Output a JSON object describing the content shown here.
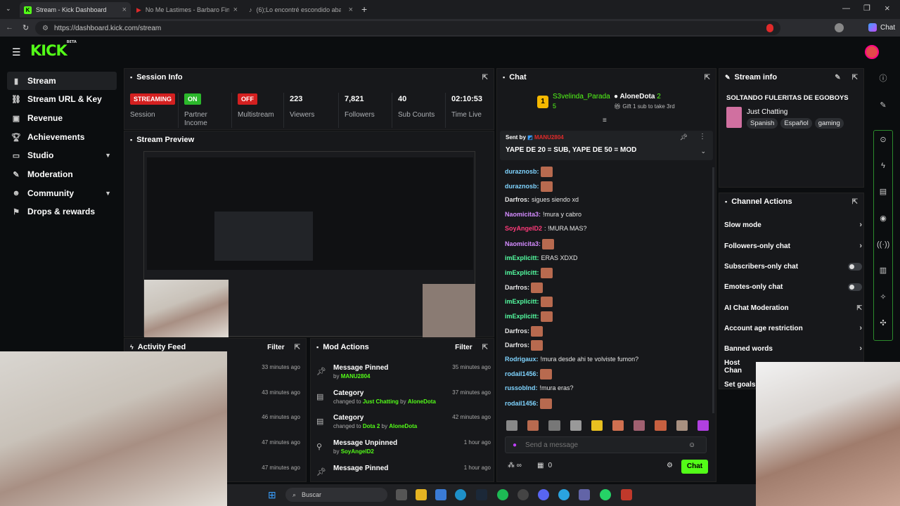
{
  "browser": {
    "tabs": [
      {
        "title": "Stream - Kick Dashboard"
      },
      {
        "title": "No Me Lastimes - Barbaro Fines y"
      },
      {
        "title": "(6);Lo encontré escondido abajo d"
      }
    ],
    "url": "https://dashboard.kick.com/stream",
    "profile_label": "Chat"
  },
  "app": {
    "logo": "KICK",
    "logo_badge": "BETA"
  },
  "sidebar": {
    "items": [
      {
        "label": "Stream",
        "icon": "stream-icon"
      },
      {
        "label": "Stream URL & Key",
        "icon": "link-icon"
      },
      {
        "label": "Revenue",
        "icon": "revenue-icon"
      },
      {
        "label": "Achievements",
        "icon": "trophy-icon"
      },
      {
        "label": "Studio",
        "icon": "studio-icon"
      },
      {
        "label": "Moderation",
        "icon": "moderation-icon"
      },
      {
        "label": "Community",
        "icon": "community-icon"
      },
      {
        "label": "Drops & rewards",
        "icon": "drops-icon"
      }
    ]
  },
  "session": {
    "title": "Session Info",
    "stats": [
      {
        "value": "STREAMING",
        "label": "Session"
      },
      {
        "value": "ON",
        "label": "Partner Income"
      },
      {
        "value": "OFF",
        "label": "Multistream"
      },
      {
        "value": "223",
        "label": "Viewers"
      },
      {
        "value": "7,821",
        "label": "Followers"
      },
      {
        "value": "40",
        "label": "Sub Counts"
      },
      {
        "value": "02:10:53",
        "label": "Time Live"
      }
    ]
  },
  "preview": {
    "title": "Stream Preview"
  },
  "activity": {
    "title": "Activity Feed",
    "filter": "Filter",
    "times": [
      "33 minutes ago",
      "43 minutes ago",
      "46 minutes ago",
      "47 minutes ago",
      "47 minutes ago"
    ]
  },
  "mod": {
    "title": "Mod Actions",
    "filter": "Filter",
    "rows": [
      {
        "title": "Message Pinned",
        "pre": "by",
        "user": "MANU2804",
        "mid": "",
        "user2": "",
        "time": "35 minutes ago"
      },
      {
        "title": "Category",
        "pre": "changed to",
        "user": "Just Chatting",
        "mid": "by",
        "user2": "AloneDota",
        "time": "37 minutes ago"
      },
      {
        "title": "Category",
        "pre": "changed to",
        "user": "Dota 2",
        "mid": "by",
        "user2": "AloneDota",
        "time": "42 minutes ago"
      },
      {
        "title": "Message Unpinned",
        "pre": "by",
        "user": "SoyAngelD2",
        "mid": "",
        "user2": "",
        "time": "1 hour ago"
      },
      {
        "title": "Message Pinned",
        "pre": "",
        "user": "",
        "mid": "",
        "user2": "",
        "time": "1 hour ago"
      }
    ]
  },
  "chat": {
    "title": "Chat",
    "top_gifter": {
      "rank": "1",
      "name": "S3velinda_Parada",
      "count": "5"
    },
    "second": {
      "name": "AloneDota",
      "count": "2",
      "note": "Gift 1 sub to take 3rd"
    },
    "pinned": {
      "sent_by": "Sent by",
      "user": "MANU2804",
      "message": "YAPE DE 20 = SUB, YAPE DE 50 = MOD"
    },
    "messages": [
      {
        "user": "duraznosb:",
        "text": "",
        "emote": true,
        "color": "#7fd4ff"
      },
      {
        "user": "duraznosb:",
        "text": "",
        "emote": true,
        "color": "#7fd4ff"
      },
      {
        "user": "Darfros:",
        "text": "sigues siendo xd",
        "emote": false,
        "color": "#e6e6e6"
      },
      {
        "user": "Naomicita3:",
        "text": "!mura y cabro",
        "emote": false,
        "color": "#d48cff"
      },
      {
        "user": "SoyAngelD2",
        "text": ": !MURA MAS?",
        "emote": false,
        "color": "#ff3a7a"
      },
      {
        "user": "Naomicita3:",
        "text": "",
        "emote": true,
        "color": "#d48cff"
      },
      {
        "user": "imExplicitt:",
        "text": "ERAS XDXD",
        "emote": false,
        "color": "#53fca0"
      },
      {
        "user": "imExplicitt:",
        "text": "",
        "emote": true,
        "color": "#53fca0"
      },
      {
        "user": "Darfros:",
        "text": "",
        "emote": true,
        "color": "#e6e6e6"
      },
      {
        "user": "imExplicitt:",
        "text": "",
        "emote": true,
        "color": "#53fca0"
      },
      {
        "user": "imExplicitt:",
        "text": "",
        "emote": true,
        "color": "#53fca0"
      },
      {
        "user": "Darfros:",
        "text": "",
        "emote": true,
        "color": "#e6e6e6"
      },
      {
        "user": "Darfros:",
        "text": "",
        "emote": true,
        "color": "#e6e6e6"
      },
      {
        "user": "Rodrigaux:",
        "text": "!mura desde ahi te volviste fumon?",
        "emote": false,
        "color": "#7fd4ff"
      },
      {
        "user": "rodail1456:",
        "text": "",
        "emote": true,
        "color": "#7fd4ff"
      },
      {
        "user": "russobInd:",
        "text": "!mura eras?",
        "emote": false,
        "color": "#7fd4ff"
      },
      {
        "user": "rodail1456:",
        "text": "",
        "emote": true,
        "color": "#7fd4ff"
      }
    ],
    "placeholder": "Send a message",
    "counter": "0",
    "send": "Chat"
  },
  "stream_info": {
    "title": "Stream info",
    "stream_title": "SOLTANDO FULERITAS DE EGOBOYS",
    "category": "Just Chatting",
    "tags": [
      "Spanish",
      "Español",
      "gaming"
    ]
  },
  "channel_actions": {
    "title": "Channel Actions",
    "rows": [
      {
        "label": "Slow mode",
        "control": "chevron"
      },
      {
        "label": "Followers-only chat",
        "control": "chevron"
      },
      {
        "label": "Subscribers-only chat",
        "control": "toggle"
      },
      {
        "label": "Emotes-only chat",
        "control": "toggle"
      },
      {
        "label": "AI Chat Moderation",
        "control": "external"
      },
      {
        "label": "Account age restriction",
        "control": "chevron"
      },
      {
        "label": "Banned words",
        "control": "chevron"
      },
      {
        "label": "Host Chan",
        "control": "none"
      },
      {
        "label": "Set goals",
        "control": "none"
      }
    ]
  },
  "taskbar": {
    "search_placeholder": "Buscar"
  },
  "colors": {
    "accent": "#53fc18",
    "danger": "#e02a2a",
    "panel": "#17181b",
    "bg": "#0b0d0f"
  }
}
